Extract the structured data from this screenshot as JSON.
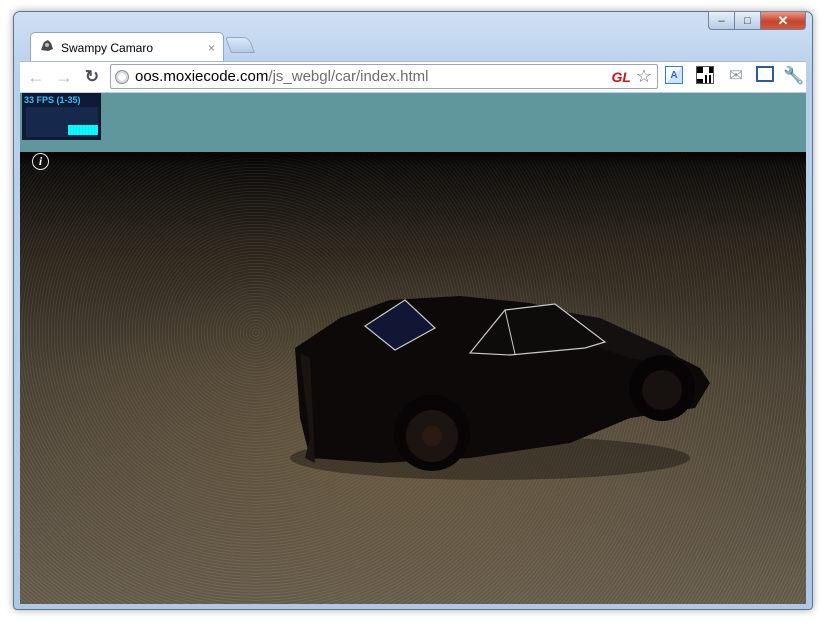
{
  "window": {
    "tab_title": "Swampy Camaro",
    "tab_close": "×",
    "controls": {
      "minimize": "–",
      "maximize": "□",
      "close": "✕"
    }
  },
  "toolbar": {
    "back": "←",
    "forward": "→",
    "reload": "↻",
    "url_host": "oos.moxiecode.com",
    "url_path": "/js_webgl/car/index.html",
    "gl_badge": "GL",
    "star": "☆"
  },
  "extensions": {
    "translate_label": "A",
    "mail": "✉",
    "wrench": "🔧"
  },
  "viewport": {
    "fps_label": "33 FPS (1-35)",
    "info_label": "i"
  },
  "colors": {
    "sky": "#60979c",
    "fps_text": "#35c0ff",
    "fps_bars": "#00ffff"
  }
}
